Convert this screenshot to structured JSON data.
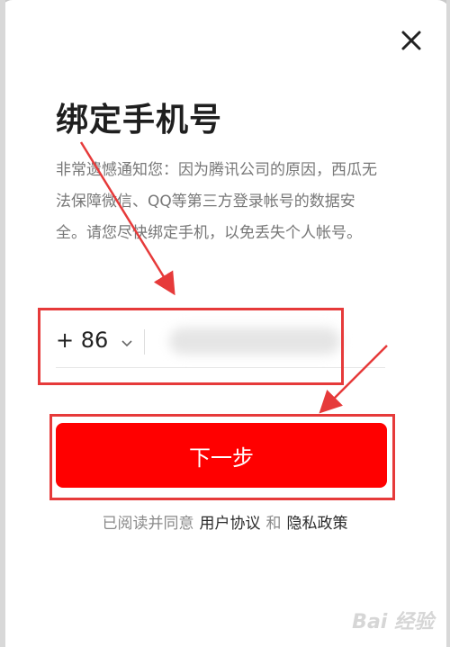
{
  "dialog": {
    "title": "绑定手机号",
    "description": "非常遗憾通知您：因为腾讯公司的原因，西瓜无法保障微信、QQ等第三方登录帐号的数据安全。请您尽快绑定手机，以免丢失个人帐号。",
    "close_icon": "close-icon"
  },
  "phone": {
    "country_code": "+ 86",
    "value": "",
    "placeholder": ""
  },
  "next_button_label": "下一步",
  "agreement": {
    "prefix": "已阅读并同意",
    "user_agreement": "用户协议",
    "and": "和",
    "privacy_policy": "隐私政策"
  },
  "watermark": "Bai 经验",
  "colors": {
    "primary_button": "#ff0000",
    "highlight_annotation": "#e63a3a"
  }
}
